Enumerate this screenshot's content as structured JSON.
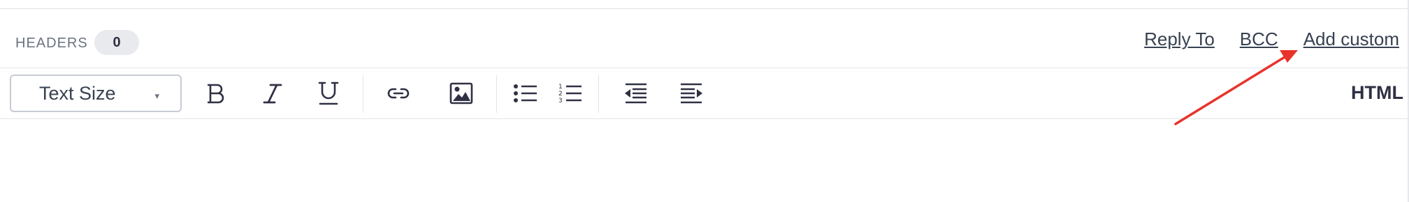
{
  "headers": {
    "label": "HEADERS",
    "count": "0",
    "links": {
      "reply_to": "Reply To",
      "bcc": "BCC",
      "add_custom": "Add custom"
    }
  },
  "toolbar": {
    "text_size": {
      "label": "Text Size",
      "caret": "▾"
    },
    "buttons": [
      "bold-icon",
      "italic-icon",
      "underline-icon",
      "link-icon",
      "image-icon",
      "bullet-list-icon",
      "numbered-list-icon",
      "outdent-icon",
      "indent-icon"
    ],
    "html_toggle": "HTML"
  },
  "colors": {
    "accent_arrow": "#e8332a",
    "text": "#2f3044",
    "muted": "#6b7280",
    "badge_bg": "#e8eaee",
    "border": "#c7cbd3"
  }
}
